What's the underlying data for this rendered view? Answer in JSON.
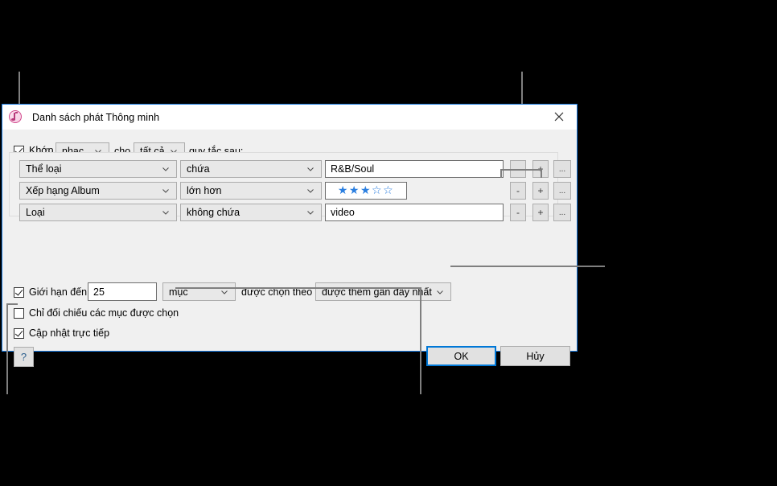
{
  "window": {
    "title": "Danh sách phát Thông minh",
    "app_icon": "itunes-music-note-icon",
    "close_icon": "close-icon"
  },
  "match_row": {
    "checkbox_label": "Khớp",
    "checkbox_checked": true,
    "media_kind": "nhạc",
    "middle_label": "cho",
    "scope": "tất cả",
    "trailing_label": "quy tắc sau:"
  },
  "rules": [
    {
      "field": "Thể loại",
      "operator": "chứa",
      "value": "R&B/Soul",
      "value_type": "text",
      "minus_label": "-",
      "plus_label": "+",
      "more_label": "..."
    },
    {
      "field": "Xếp hạng Album",
      "operator": "lớn hơn",
      "value": "★★★☆☆",
      "value_type": "rating",
      "rating_filled": 3,
      "rating_total": 5,
      "minus_label": "-",
      "plus_label": "+",
      "more_label": "..."
    },
    {
      "field": "Loại",
      "operator": "không chứa",
      "value": "video",
      "value_type": "text",
      "minus_label": "-",
      "plus_label": "+",
      "more_label": "..."
    }
  ],
  "limit_row": {
    "checkbox_label": "Giới hạn đến",
    "checkbox_checked": true,
    "amount": "25",
    "unit": "mục",
    "selected_by_label": "được chọn theo",
    "sort_order": "được thêm gần đây nhất"
  },
  "match_only_checked_row": {
    "label": "Chỉ đối chiếu các mục được chọn",
    "checked": false
  },
  "live_updating_row": {
    "label": "Cập nhật trực tiếp",
    "checked": true
  },
  "buttons": {
    "help": "?",
    "ok": "OK",
    "cancel": "Hủy"
  },
  "colors": {
    "accent": "#0078d7",
    "window_border": "#1a7ae0",
    "star": "#2b7fe0",
    "callout_line": "#7f7f7f",
    "dialog_bg": "#f0f0f0",
    "backdrop": "#000000"
  }
}
